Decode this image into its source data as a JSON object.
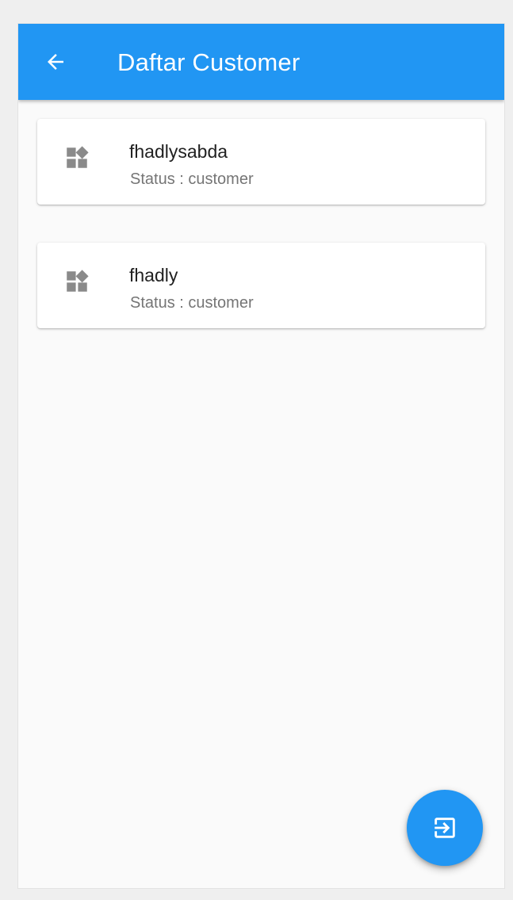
{
  "appbar": {
    "title": "Daftar Customer",
    "back_icon": "arrow-back-icon",
    "color": "#2196f3"
  },
  "customers": [
    {
      "name": "fhadlysabda",
      "status": "Status : customer",
      "icon": "widgets-icon"
    },
    {
      "name": "fhadly",
      "status": "Status : customer",
      "icon": "widgets-icon"
    }
  ],
  "fab": {
    "icon": "exit-to-app-icon",
    "color": "#2196f3"
  }
}
